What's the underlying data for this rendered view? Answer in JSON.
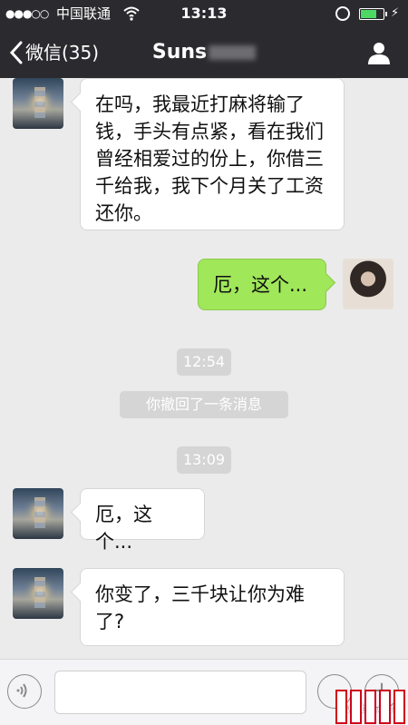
{
  "status_bar": {
    "signal": "●●●○○",
    "carrier": "中国联通",
    "time": "13:13",
    "battery_level": 0.75,
    "battery_color": "#4cd964"
  },
  "nav": {
    "back_label": "微信(35)",
    "title": "Suns",
    "back_icon": "chevron-left-icon",
    "profile_icon": "person-icon"
  },
  "messages": [
    {
      "side": "left",
      "text": "在吗，我最近打麻将输了钱，手头有点紧，看在我们曾经相爱过的份上，你借三千给我，我下个月关了工资还你。"
    },
    {
      "side": "right",
      "text": "厄，这个..."
    },
    {
      "type": "time",
      "text": "12:54"
    },
    {
      "type": "system",
      "text": "你撤回了一条消息"
    },
    {
      "type": "time",
      "text": "13:09"
    },
    {
      "side": "left",
      "text": "厄，这个..."
    },
    {
      "side": "left",
      "text": "你变了，三千块让你为难了?"
    }
  ],
  "input_bar": {
    "placeholder": "",
    "voice_icon": "voice-icon",
    "emoji_icon": "emoji-icon",
    "plus_icon": "plus-icon"
  },
  "watermark": "weibo.com/",
  "colors": {
    "nav_bg": "#2b2b2f",
    "chat_bg": "#ebebeb",
    "my_bubble": "#a0e75a",
    "their_bubble": "#ffffff"
  }
}
